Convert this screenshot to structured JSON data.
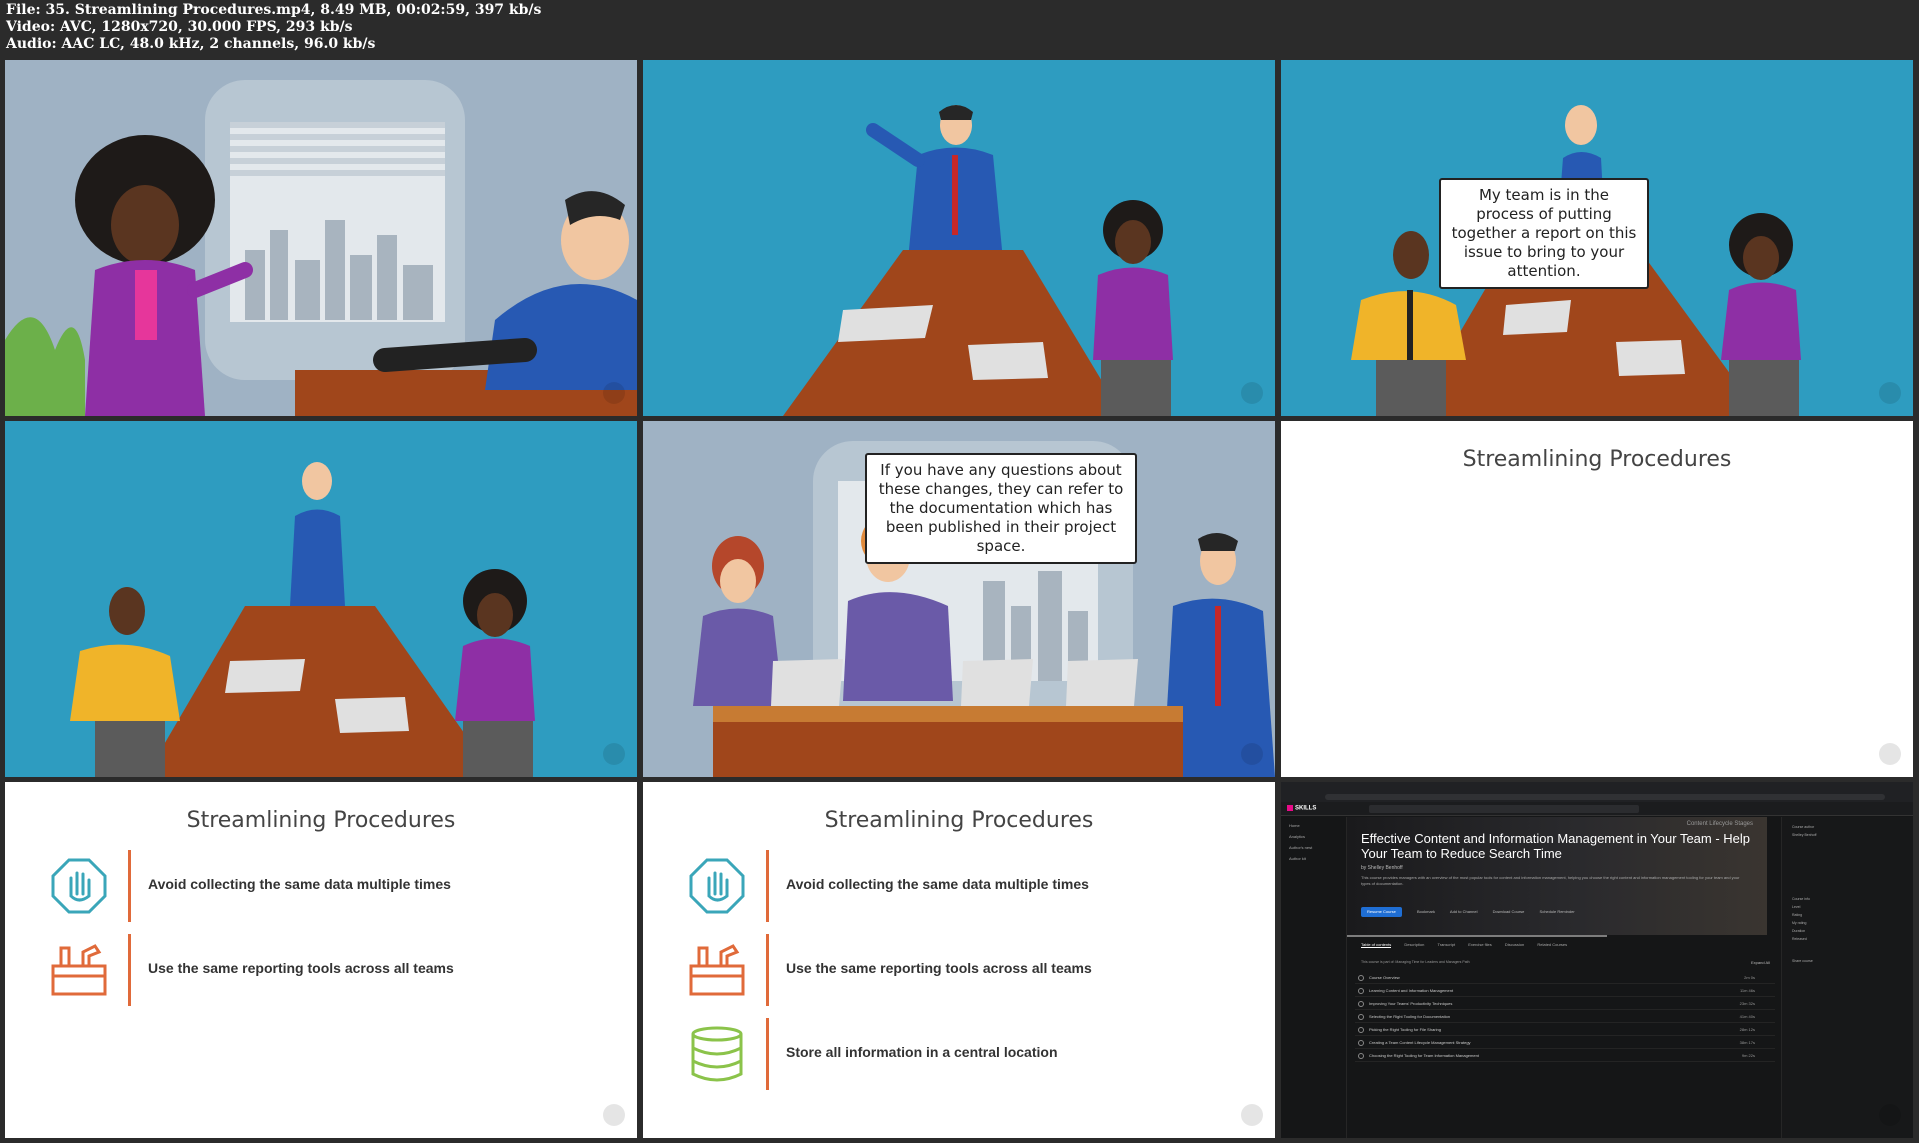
{
  "header": {
    "file_line": "File: 35. Streamlining Procedures.mp4, 8.49 MB, 00:02:59, 397 kb/s",
    "video_line": "Video: AVC, 1280x720, 30.000 FPS, 293 kb/s",
    "audio_line": "Audio: AAC LC, 48.0 kHz, 2 channels, 96.0 kb/s"
  },
  "colors": {
    "scene_blue": "#2e9cc0",
    "office_gray": "#9fb2c4",
    "table_brown": "#a0461b",
    "accent_orange": "#e06a3a",
    "icon_teal": "#3aa6b9",
    "icon_green": "#8bc34a",
    "brand_pink": "#e80a89",
    "resume_blue": "#1f6ed4"
  },
  "frames": {
    "f3_bubble": "My team is in the process of putting together a report on this issue to bring to your attention.",
    "f5_bubble": "If you have any questions about these changes, they can refer to the documentation which has been published in their project space.",
    "f6_title": "Streamlining Procedures",
    "f7": {
      "title": "Streamlining Procedures",
      "points": [
        {
          "icon": "hand-stop-icon",
          "text": "Avoid collecting the same data multiple times"
        },
        {
          "icon": "toolbox-icon",
          "text": "Use the same reporting tools across all teams"
        }
      ]
    },
    "f8": {
      "title": "Streamlining Procedures",
      "points": [
        {
          "icon": "hand-stop-icon",
          "text": "Avoid collecting the same data multiple times"
        },
        {
          "icon": "toolbox-icon",
          "text": "Use the same reporting tools across all teams"
        },
        {
          "icon": "database-icon",
          "text": "Store all information in a central location"
        }
      ]
    },
    "f9": {
      "brand": "SKILLS",
      "stage": "Content Lifecycle Stages",
      "course_title": "Effective Content and Information Management in Your Team - Help Your Team to Reduce Search Time",
      "author": "by Shelley Benhoff",
      "description": "This course provides managers with an overview of the most popular tools for content and information management, helping you choose the right content and information management tooling for your team and your types of documentation.",
      "resume_label": "Resume Course",
      "actions": [
        "Bookmark",
        "Add to Channel",
        "Download Course",
        "Schedule Reminder"
      ],
      "tabs": [
        "Table of contents",
        "Description",
        "Transcript",
        "Exercise files",
        "Discussion",
        "Related Courses"
      ],
      "part_of": "This course is part of: Managing Time for Leaders and Managers Path",
      "expand_all": "Expand All",
      "modules": [
        {
          "title": "Course Overview",
          "duration": "2m 0s"
        },
        {
          "title": "Learning Content and Information Management",
          "duration": "11m 46s"
        },
        {
          "title": "Improving Your Teams' Productivity Techniques",
          "duration": "23m 32s"
        },
        {
          "title": "Selecting the Right Tooling for Documentation",
          "duration": "41m 40s"
        },
        {
          "title": "Picking the Right Tooling for File Sharing",
          "duration": "28m 12s"
        },
        {
          "title": "Creating a Team Content Lifecycle Management Strategy",
          "duration": "38m 17s"
        },
        {
          "title": "Choosing the Right Tooling for Team Information Management",
          "duration": "9m 22s"
        }
      ],
      "sidebar": [
        "Home",
        "Analytics",
        "Author's nest",
        "Author kit"
      ],
      "right_panel": [
        "Course author",
        "Shelley Benhoff",
        "Course info",
        "Level",
        "Rating",
        "My rating",
        "Duration",
        "Released",
        "Share course"
      ]
    }
  }
}
